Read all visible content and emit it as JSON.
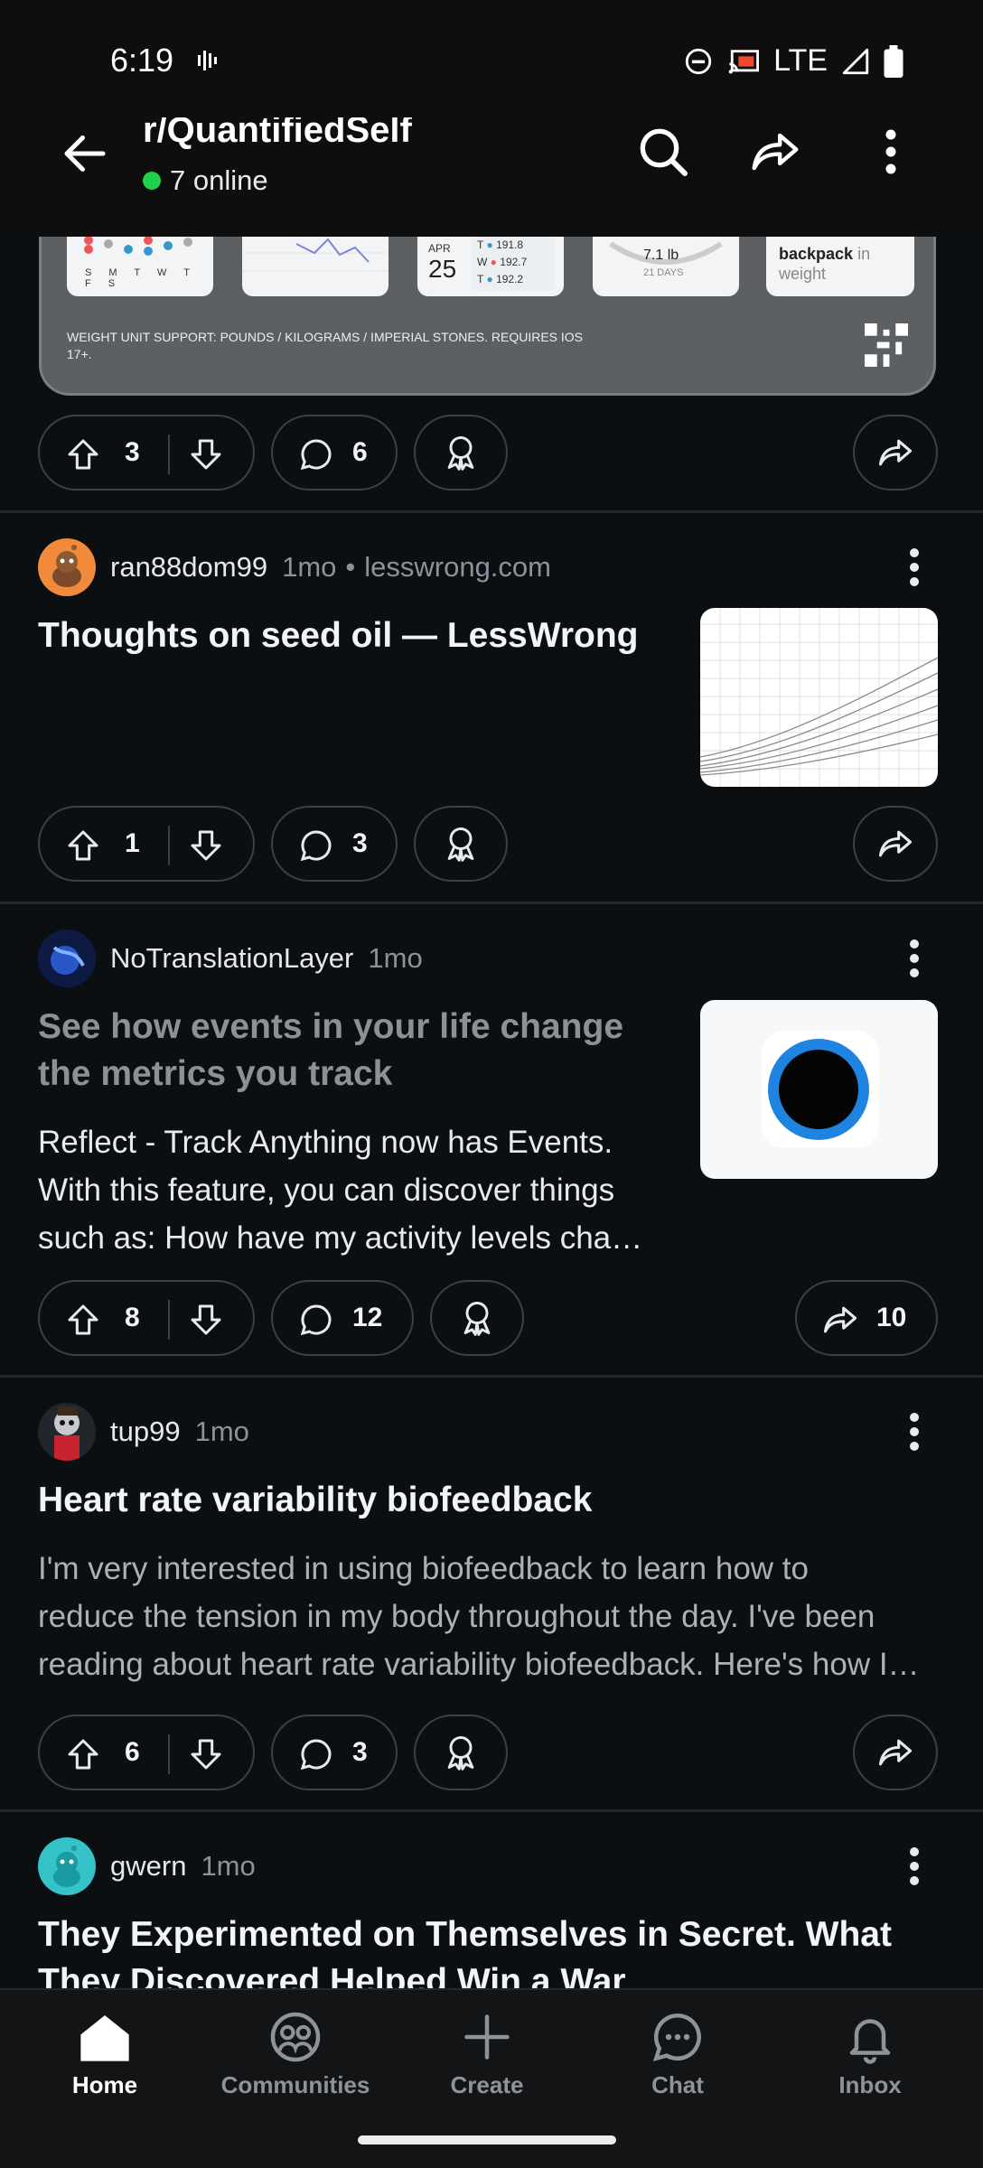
{
  "status_bar": {
    "time": "6:19",
    "network": "LTE"
  },
  "header": {
    "subreddit": "r/QuantifiedSelf",
    "online": "7 online"
  },
  "promo": {
    "thumb_texts": [
      "APR",
      "25",
      "T",
      "191.8",
      "W",
      "192.7",
      "T",
      "192.2",
      "7.1 lb",
      "21 DAYS",
      "backpack",
      "in",
      "weight"
    ],
    "days": "S M T W T F S",
    "note": "WEIGHT UNIT SUPPORT: POUNDS / KILOGRAMS / IMPERIAL STONES. REQUIRES IOS 17+.",
    "upvotes": "3",
    "comments": "6"
  },
  "posts": [
    {
      "author": "ran88dom99",
      "age": "1mo",
      "domain": "lesswrong.com",
      "title": "Thoughts on seed oil — LessWrong",
      "upvotes": "1",
      "comments": "3"
    },
    {
      "author": "NoTranslationLayer",
      "age": "1mo",
      "title_line1": "See how events in your life change",
      "title_line2": "the metrics you track",
      "body_line1": "Reflect - Track Anything now has Events.",
      "body_line2": "With this feature, you can discover things",
      "body_line3": "such as: How have my activity levels cha…",
      "upvotes": "8",
      "comments": "12",
      "shares": "10"
    },
    {
      "author": "tup99",
      "age": "1mo",
      "title": "Heart rate variability biofeedback",
      "body_line1": "I'm very interested in using biofeedback to learn how to",
      "body_line2": "reduce the tension in my body throughout the day. I've been",
      "body_line3": "reading about heart rate variability biofeedback. Here's how I…",
      "upvotes": "6",
      "comments": "3"
    },
    {
      "author": "gwern",
      "age": "1mo",
      "title_line1": "They Experimented on Themselves in Secret. What",
      "title_line2": "They Discovered Helped Win a War"
    }
  ],
  "nav": {
    "home": "Home",
    "communities": "Communities",
    "create": "Create",
    "chat": "Chat",
    "inbox": "Inbox"
  },
  "colors": {
    "online_green": "#1fd14a",
    "background": "#0b0f12",
    "pill_border": "#3b4046"
  }
}
